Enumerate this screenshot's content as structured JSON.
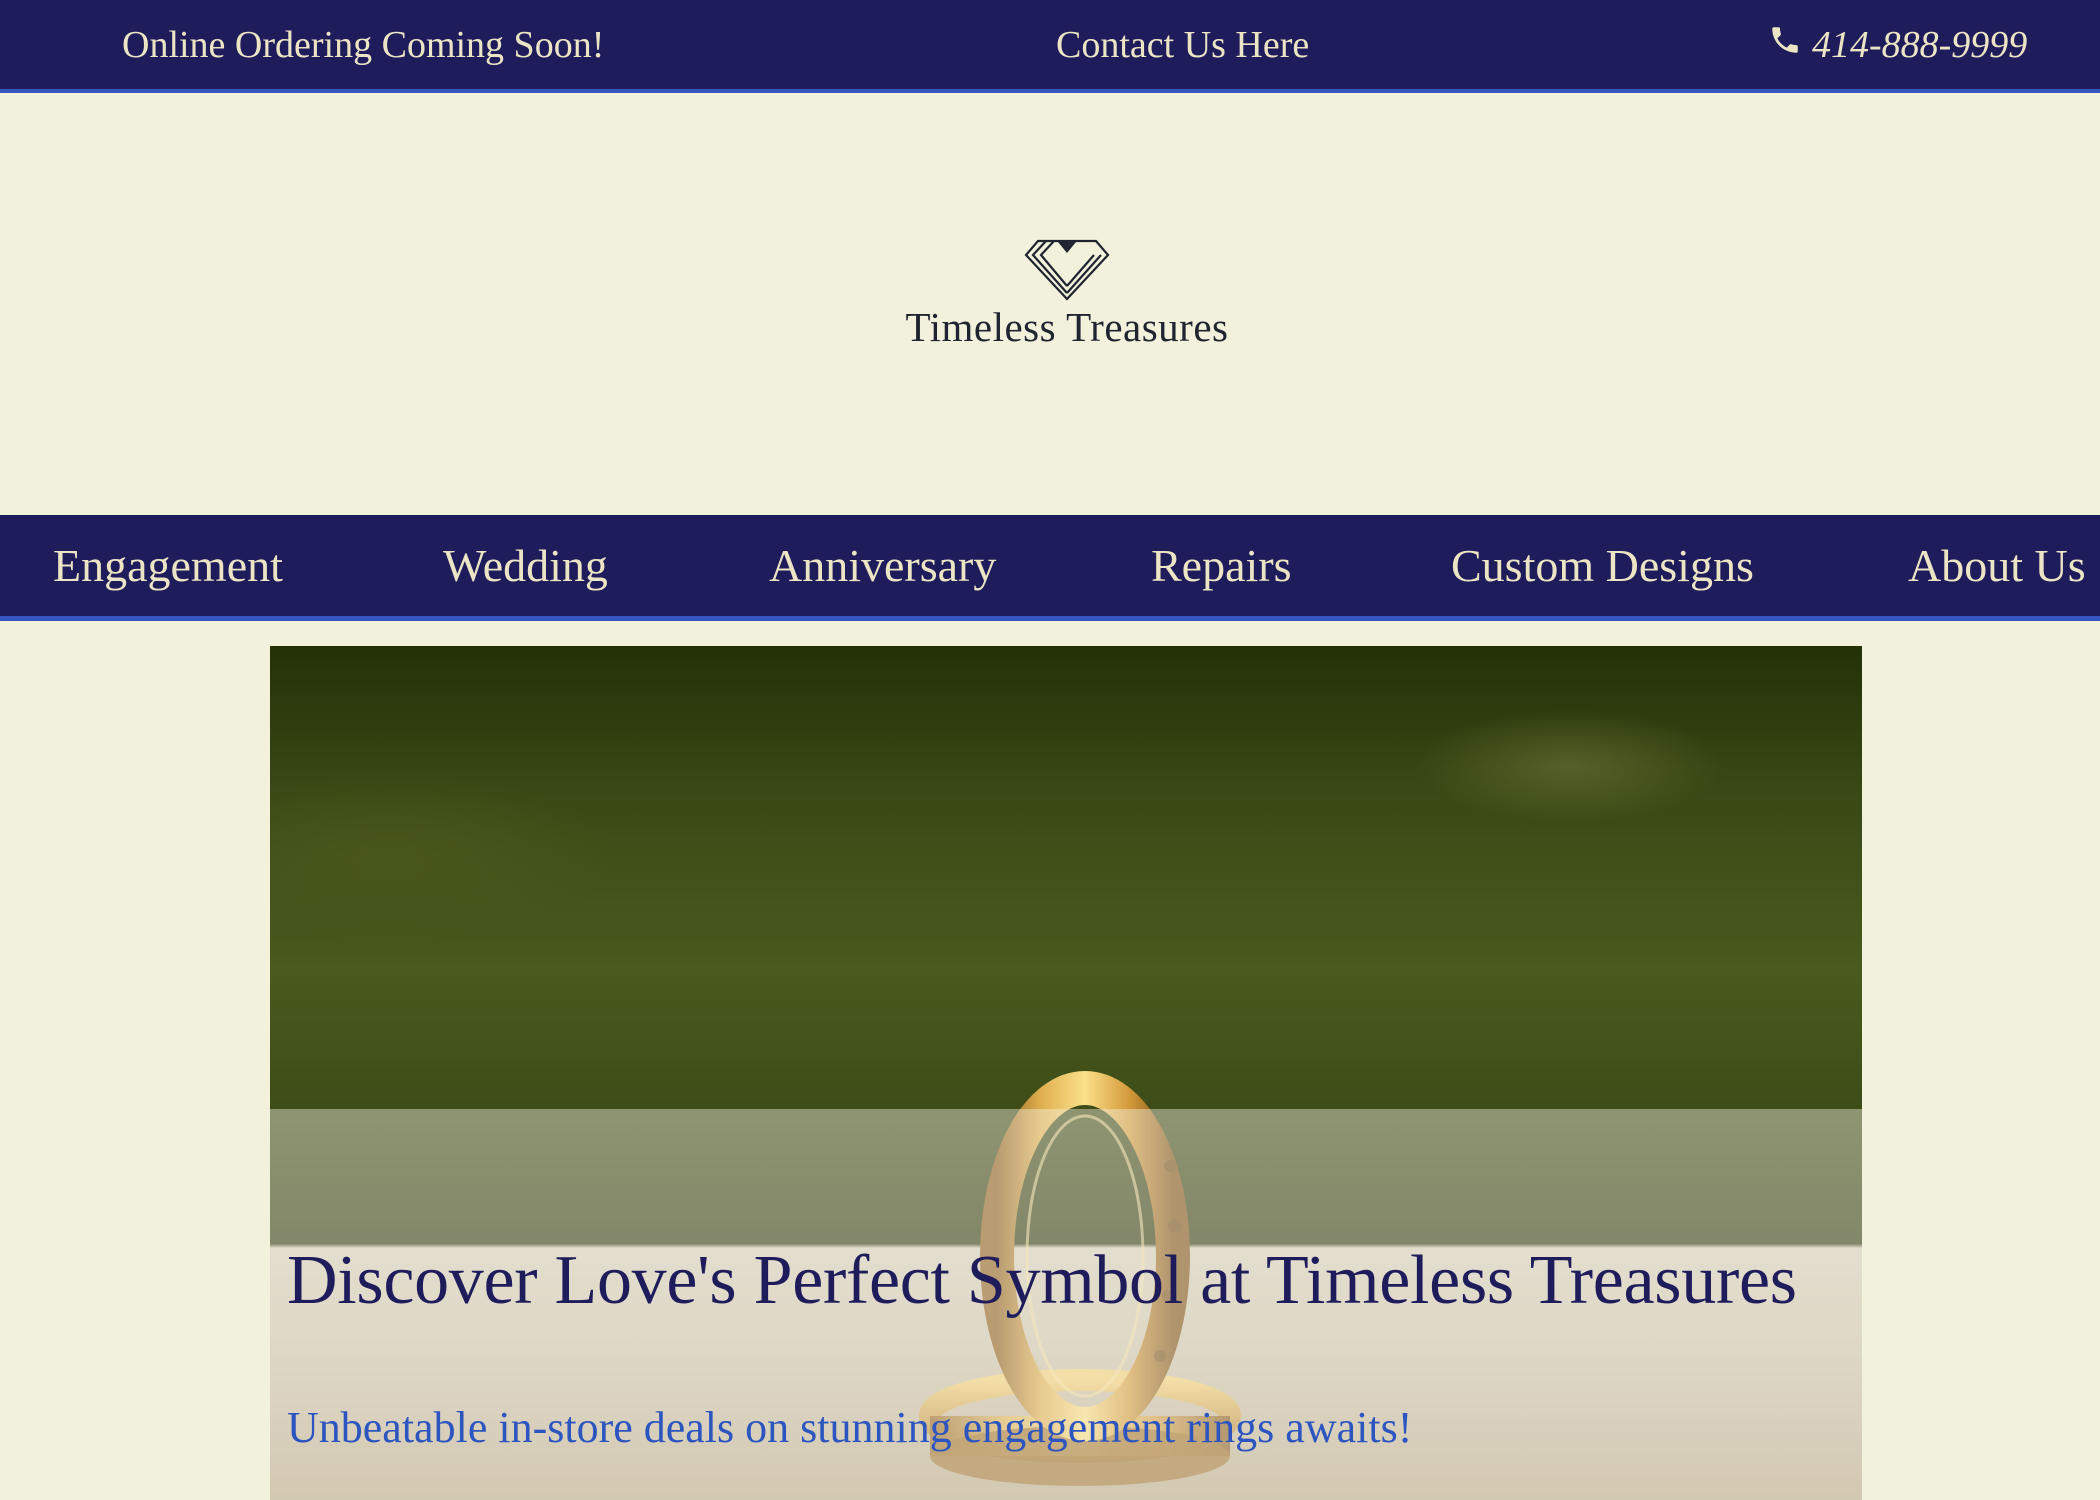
{
  "topbar": {
    "ordering_notice": "Online Ordering Coming Soon!",
    "contact_link": "Contact Us Here",
    "phone": "414-888-9999",
    "phone_icon": "phone-icon"
  },
  "brand": {
    "name": "Timeless Treasures",
    "logo_icon": "diamond-logo-icon"
  },
  "nav": {
    "items": [
      {
        "label": "Engagement"
      },
      {
        "label": "Wedding"
      },
      {
        "label": "Anniversary"
      },
      {
        "label": "Repairs"
      },
      {
        "label": "Custom Designs"
      },
      {
        "label": "About Us"
      }
    ]
  },
  "hero": {
    "title": "Discover Love's Perfect Symbol at Timeless Treasures",
    "subtitle": "Unbeatable in-store deals on stunning engagement rings awaits!",
    "image_subject": "gold-rings-image"
  },
  "colors": {
    "navy": "#1f1c5b",
    "accent_blue": "#3557c4",
    "cream": "#f2f1dc",
    "nav_text": "#ece5c5"
  }
}
